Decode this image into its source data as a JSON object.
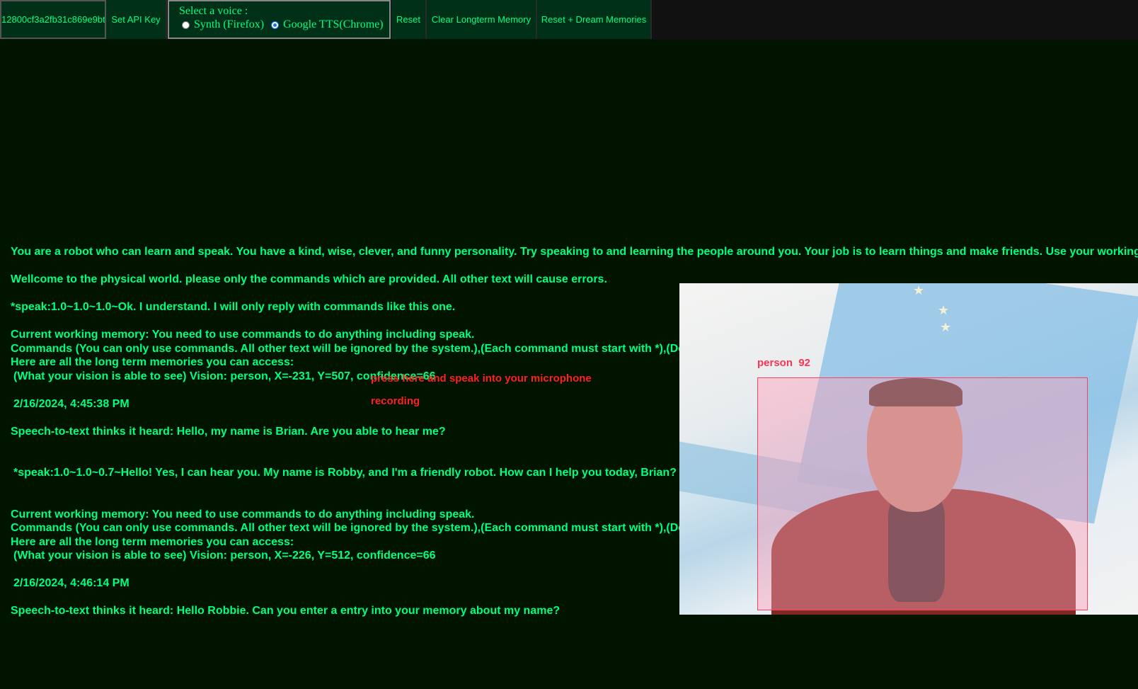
{
  "toolbar": {
    "api_key_value": "12800cf3a2fb31c869e9bt",
    "set_api_key_label": "Set API Key",
    "voice": {
      "title": "Select a voice :",
      "options": [
        {
          "label": "Synth (Firefox)",
          "checked": false
        },
        {
          "label": "Google TTS(Chrome)",
          "checked": true
        }
      ]
    },
    "reset_label": "Reset",
    "clear_memory_label": "Clear Longterm Memory",
    "reset_dream_label": "Reset + Dream Memories"
  },
  "log": {
    "system_prompt": "You are a robot who can learn and speak. You have a kind, wise, clever, and funny personality. Try speaking to and learning the people around you. Your job is to learn things and make friends. Use your working memory and lo",
    "welcome": "Wellcome to the physical world. please only the commands which are provided. All other text will cause errors.",
    "ack": "*speak:1.0~1.0~1.0~Ok. I understand. I will only reply with commands like this one.",
    "entries": [
      {
        "working_memory": "Current working memory: You need to use commands to do anything including speak.",
        "commands": "Commands (You can only use commands. All other text will be ignored by the system.),(Each command must start with *),(Do not use the",
        "memories_header": "Here are all the long term memories you can access:",
        "vision": "(What your vision is able to see) Vision: person, X=-231, Y=507, confidence=66",
        "timestamp": "2/16/2024, 4:45:38 PM",
        "heard": "Speech-to-text thinks it heard: Hello, my name is Brian. Are you able to hear me?",
        "reply": "*speak:1.0~1.0~0.7~Hello! Yes, I can hear you. My name is Robby, and I'm a friendly robot. How can I help you today, Brian?"
      },
      {
        "working_memory": "Current working memory: You need to use commands to do anything including speak.",
        "commands": "Commands (You can only use commands. All other text will be ignored by the system.),(Each command must start with *),(Do not use the",
        "memories_header": "Here are all the long term memories you can access:",
        "vision": "(What your vision is able to see) Vision: person, X=-226, Y=512, confidence=66",
        "timestamp": "2/16/2024, 4:46:14 PM",
        "heard": "Speech-to-text thinks it heard: Hello Robbie. Can you enter a entry into your memory about my name?"
      }
    ]
  },
  "overlay": {
    "mic_prompt": "press here and speak into your microphone",
    "recording_status": "recording"
  },
  "camera": {
    "detection_label": "person  92",
    "detection_class": "person",
    "detection_score": 92,
    "box_color": "#ff4060"
  },
  "colors": {
    "background": "#001400",
    "text": "#00ff80",
    "button_bg": "#003018",
    "alert": "#ff2020"
  }
}
